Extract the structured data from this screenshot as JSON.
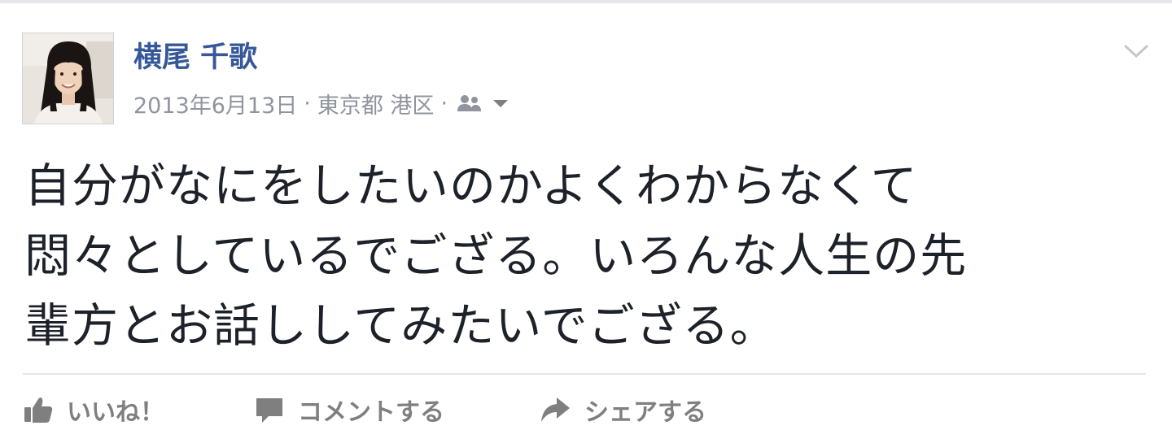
{
  "post": {
    "author": "横尾 千歌",
    "date": "2013年6月13日",
    "separator": "·",
    "location": "東京都 港区",
    "audience_icon": "friends-icon",
    "message_lines": [
      "自分がなにをしたいのかよくわからなくて",
      "悶々としているでござる。いろんな人生の先",
      "輩方とお話ししてみたいでござる。"
    ]
  },
  "actions": {
    "like": "いいね！",
    "comment": "コメントする",
    "share": "シェアする"
  },
  "colors": {
    "author": "#365899",
    "meta": "#90949c",
    "message": "#1d2129",
    "action": "#7f7f7f",
    "divider": "#e5e6e9"
  }
}
